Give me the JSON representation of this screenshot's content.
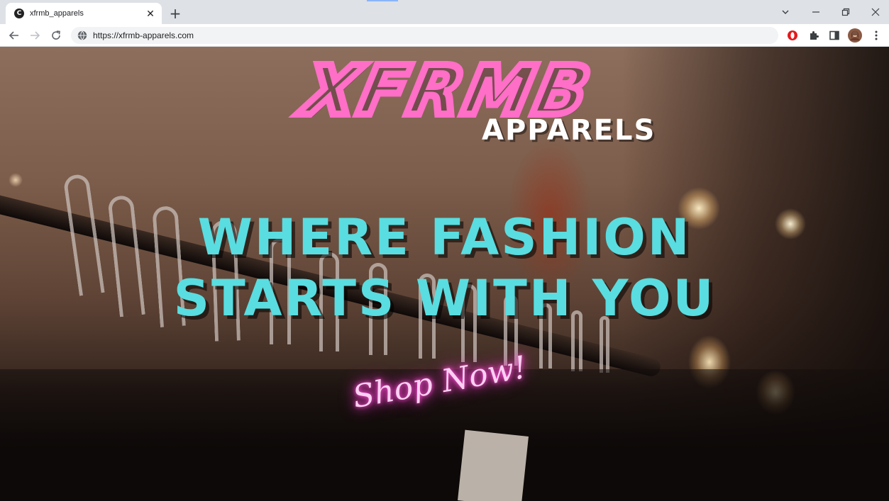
{
  "browser": {
    "tab": {
      "title": "xfrmb_apparels",
      "favicon_letter": "C",
      "close_glyph": "✕"
    },
    "new_tab_glyph": "+",
    "window_controls": {
      "dropdown": "⌄",
      "minimize": "—",
      "restore": "❐",
      "close": "✕"
    },
    "nav": {
      "back": "←",
      "forward": "→",
      "reload": "↻"
    },
    "url": "https://xfrmb-apparels.com",
    "menu_glyph": "⋮"
  },
  "hero": {
    "logo_script": "XFRMB",
    "logo_sub": "APPARELS",
    "headline_line1": "WHERE FASHION",
    "headline_line2": "STARTS WITH YOU",
    "cta": "Shop Now!"
  },
  "colors": {
    "logo_pink": "#ff6ec7",
    "headline_cyan": "#59dde0",
    "cta_neon": "#ff3fd0"
  }
}
